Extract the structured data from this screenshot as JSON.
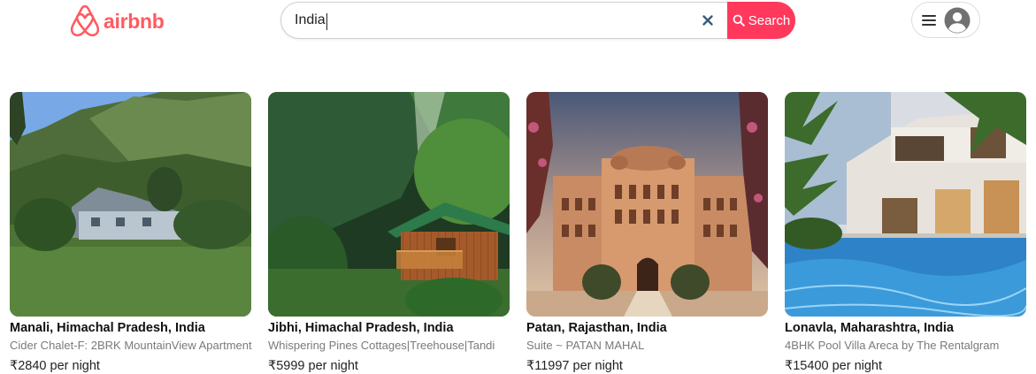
{
  "brand": {
    "name": "airbnb",
    "color": "#ff5a60"
  },
  "search": {
    "value": "India",
    "placeholder": "",
    "clear_icon": "close-icon",
    "button_label": "Search",
    "button_color": "#ff385c"
  },
  "user_menu": {
    "menu_icon": "hamburger-icon",
    "avatar_icon": "user-avatar-icon"
  },
  "listings": [
    {
      "title": "Manali, Himachal Pradesh, India",
      "subtitle": "Cider Chalet-F: 2BRK MountainView Apartment",
      "price": "₹2840",
      "price_suffix": "per night"
    },
    {
      "title": "Jibhi, Himachal Pradesh, India",
      "subtitle": "Whispering Pines Cottages|Treehouse|Tandi",
      "price": "₹5999",
      "price_suffix": "per night"
    },
    {
      "title": "Patan, Rajasthan, India",
      "subtitle": "Suite ~ PATAN MAHAL",
      "price": "₹11997",
      "price_suffix": "per night"
    },
    {
      "title": "Lonavla, Maharashtra, India",
      "subtitle": "4BHK Pool Villa Areca by The Rentalgram",
      "price": "₹15400",
      "price_suffix": "per night"
    }
  ]
}
